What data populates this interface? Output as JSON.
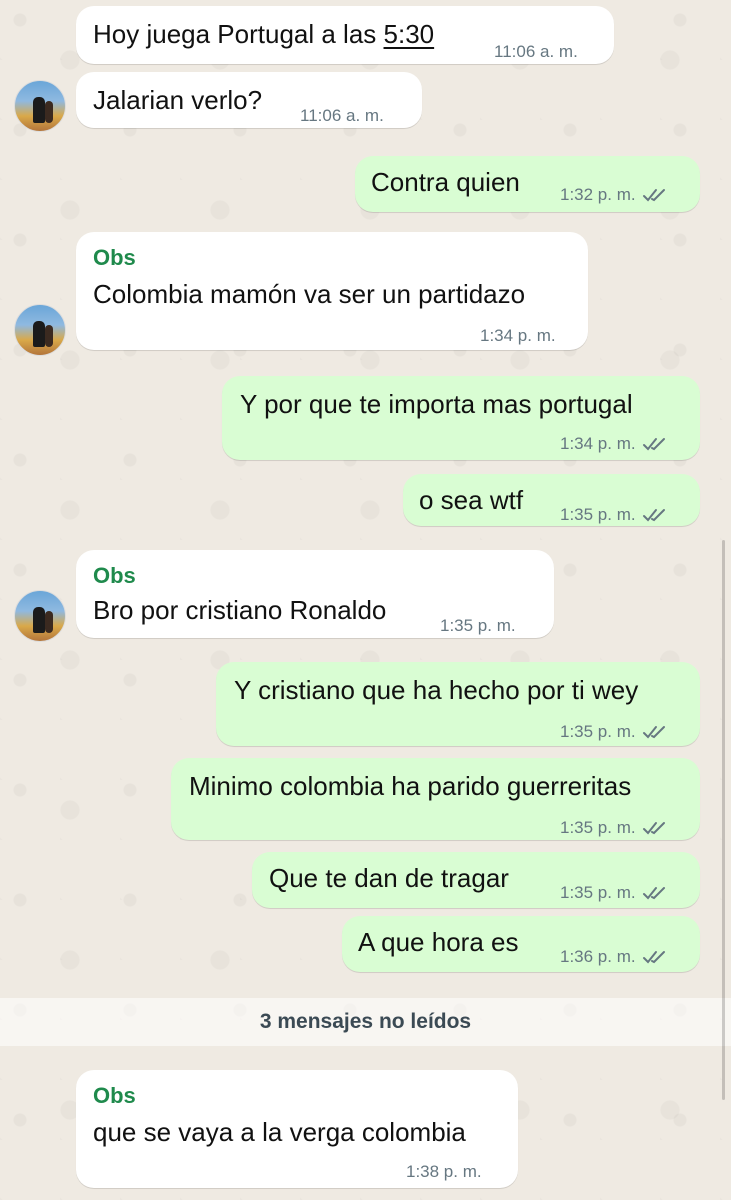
{
  "messages": [
    {
      "text_prefix": "Hoy juega Portugal a las ",
      "text_link": "5:30",
      "time": "11:06 a. m."
    },
    {
      "text": "Jalarian verlo?",
      "time": "11:06 a. m."
    },
    {
      "text": "Contra quien",
      "time": "1:32 p. m."
    },
    {
      "sender": "Obs",
      "text": "Colombia mamón va ser un partidazo",
      "time": "1:34 p. m."
    },
    {
      "text": "Y por que te importa mas portugal",
      "time": "1:34 p. m."
    },
    {
      "text": "o sea wtf",
      "time": "1:35 p. m."
    },
    {
      "sender": "Obs",
      "text": "Bro por cristiano Ronaldo",
      "time": "1:35 p. m."
    },
    {
      "text": "Y cristiano que ha hecho por ti wey",
      "time": "1:35 p. m."
    },
    {
      "text": "Minimo colombia ha parido guerreritas",
      "time": "1:35 p. m."
    },
    {
      "text": "Que te dan de tragar",
      "time": "1:35 p. m."
    },
    {
      "text": "A que hora es",
      "time": "1:36 p. m."
    },
    {
      "sender": "Obs",
      "text": "que se vaya a la verga colombia",
      "time": "1:38 p. m."
    }
  ],
  "unread_banner": "3 mensajes no leídos",
  "colors": {
    "background": "#efeae2",
    "incoming": "#ffffff",
    "outgoing": "#d9fdd3",
    "sender_name": "#1f8a4c",
    "meta": "#667781",
    "read_ticks": "#667781"
  },
  "icons": {
    "read_receipt": "double-check-icon"
  }
}
